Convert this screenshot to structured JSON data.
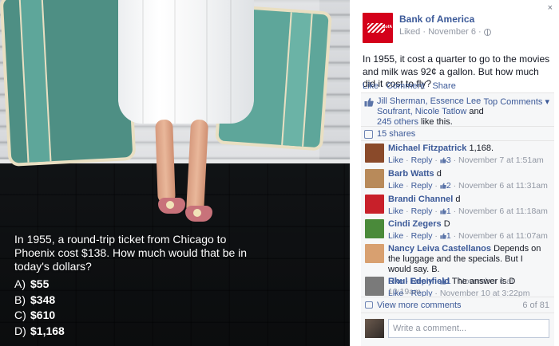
{
  "photo": {
    "question": "In 1955, a round-trip ticket from Chicago to Phoenix cost $138. How much would that be in today's dollars?",
    "answers": [
      {
        "letter": "A)",
        "value": "$55"
      },
      {
        "letter": "B)",
        "value": "$348"
      },
      {
        "letter": "C)",
        "value": "$610"
      },
      {
        "letter": "D)",
        "value": "$1,168"
      }
    ]
  },
  "close_label": "×",
  "post": {
    "page_name": "Bank of America",
    "logo_text": "BofA",
    "meta": "Liked · November 6 ·",
    "text": "In 1955, it cost a quarter to go to the movies and milk was 92¢ a gallon. But how much did it cost to fly?",
    "actions": [
      "Like",
      "Comment",
      "Share"
    ]
  },
  "ufi": {
    "likes_names": "Jill Sherman, Essence Lee Soufrant, Nicole Tatlow",
    "likes_and": " and ",
    "likes_others": "245 others",
    "likes_suffix": " like this.",
    "top_comments": "Top Comments ▾",
    "shares": "15 shares",
    "comments": [
      {
        "author": "Michael Fitzpatrick",
        "text": "1,168.",
        "like": "Like",
        "reply": "Reply",
        "likes": "3",
        "time": "November 7 at 1:51am",
        "avatar_color": "#8a4a2a"
      },
      {
        "author": "Barb Watts",
        "text": "d",
        "like": "Like",
        "reply": "Reply",
        "likes": "2",
        "time": "November 6 at 11:31am",
        "avatar_color": "#b88a5a"
      },
      {
        "author": "Brandi Channel",
        "text": "d",
        "like": "Like",
        "reply": "Reply",
        "likes": "1",
        "time": "November 6 at 11:18am",
        "avatar_color": "#c8202a"
      },
      {
        "author": "Cindi Zegers",
        "text": "D",
        "like": "Like",
        "reply": "Reply",
        "likes": "1",
        "time": "November 6 at 11:07am",
        "avatar_color": "#4a8a3a"
      },
      {
        "author": "Nancy Leiva Castellanos",
        "text": "Depends on the luggage and the specials. But I would say. B.",
        "like": "Like",
        "reply": "Reply",
        "likes": "1",
        "time": "November 6 at 10:19am",
        "avatar_color": "#d8a070"
      },
      {
        "author": "Rhul Edenfield",
        "text": "The answer is D",
        "like": "Like",
        "reply": "Reply",
        "likes": "",
        "time": "November 10 at 3:22pm",
        "avatar_color": "#7a7a7a"
      }
    ],
    "view_more": "View more comments",
    "count": "6 of 81",
    "write_placeholder": "Write a comment..."
  }
}
